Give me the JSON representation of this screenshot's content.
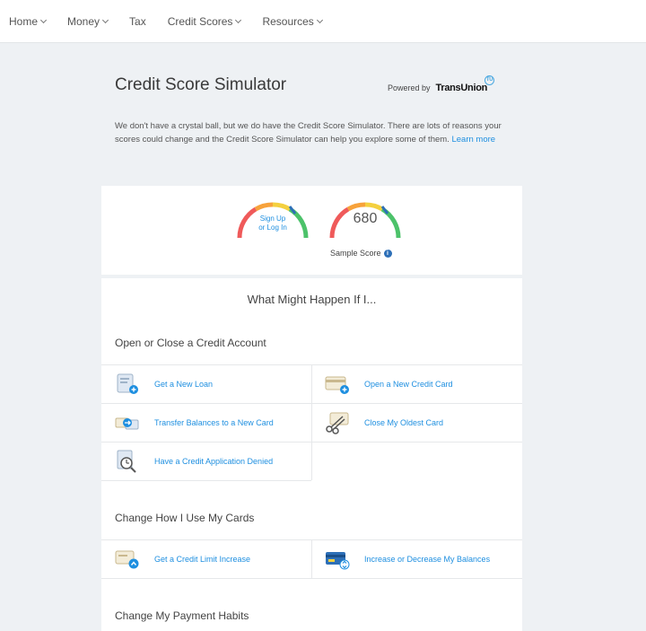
{
  "nav": {
    "items": [
      {
        "label": "Home",
        "has_menu": true
      },
      {
        "label": "Money",
        "has_menu": true
      },
      {
        "label": "Tax",
        "has_menu": false
      },
      {
        "label": "Credit Scores",
        "has_menu": true
      },
      {
        "label": "Resources",
        "has_menu": true
      }
    ]
  },
  "header": {
    "title": "Credit Score Simulator",
    "powered_by": "Powered by",
    "brand": "TransUnion",
    "brand_badge": "TU"
  },
  "intro": {
    "text": "We don't have a crystal ball, but we do have the Credit Score Simulator. There are lots of reasons your scores could change and the Credit Score Simulator can help you explore some of them.",
    "learn_more": "Learn more"
  },
  "scores": {
    "signup_line1": "Sign Up",
    "signup_line2": "or Log In",
    "sample_score": "680",
    "sample_label": "Sample Score",
    "info_glyph": "i"
  },
  "simulator": {
    "heading": "What Might Happen If I...",
    "sections": [
      {
        "title": "Open or Close a Credit Account",
        "options": [
          {
            "label": "Get a New Loan",
            "icon": "loan-document-icon"
          },
          {
            "label": "Open a New Credit Card",
            "icon": "new-credit-card-icon"
          },
          {
            "label": "Transfer Balances to a New Card",
            "icon": "transfer-balance-icon"
          },
          {
            "label": "Close My Oldest Card",
            "icon": "cut-card-icon"
          },
          {
            "label": "Have a Credit Application Denied",
            "icon": "denied-application-icon"
          }
        ]
      },
      {
        "title": "Change How I Use My Cards",
        "options": [
          {
            "label": "Get a Credit Limit Increase",
            "icon": "limit-increase-icon"
          },
          {
            "label": "Increase or Decrease My Balances",
            "icon": "balance-change-icon"
          }
        ]
      },
      {
        "title": "Change My Payment Habits",
        "options": []
      }
    ]
  },
  "colors": {
    "link": "#1e8fe0",
    "gauge_red": "#ef5a5a",
    "gauge_orange": "#f7a23b",
    "gauge_yellow": "#f4d03f",
    "gauge_green": "#4cc26a",
    "gauge_blue": "#2d6fb7"
  }
}
